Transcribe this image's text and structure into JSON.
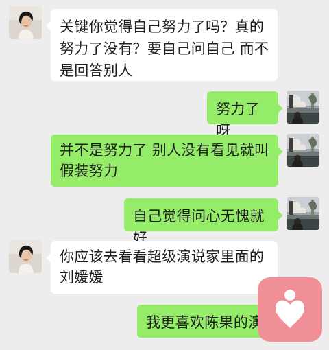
{
  "messages": [
    {
      "side": "left",
      "text": "关键你觉得自己努力了吗？真的努力了没有？要自己问自己 而不是回答别人"
    },
    {
      "side": "right",
      "text": "努力了呀"
    },
    {
      "side": "right",
      "text": "并不是努力了 别人没有看见就叫假装努力"
    },
    {
      "side": "right",
      "text": "自己觉得问心无愧就好"
    },
    {
      "side": "left",
      "text": "你应该去看看超级演说家里面的刘媛媛"
    },
    {
      "side": "right",
      "text": "我更喜欢陈果的演"
    }
  ],
  "colors": {
    "background": "#ededed",
    "incoming_bubble": "#ffffff",
    "outgoing_bubble": "#95ec69",
    "fab": "#f08f96"
  },
  "icons": {
    "fab": "heart-person-icon"
  }
}
